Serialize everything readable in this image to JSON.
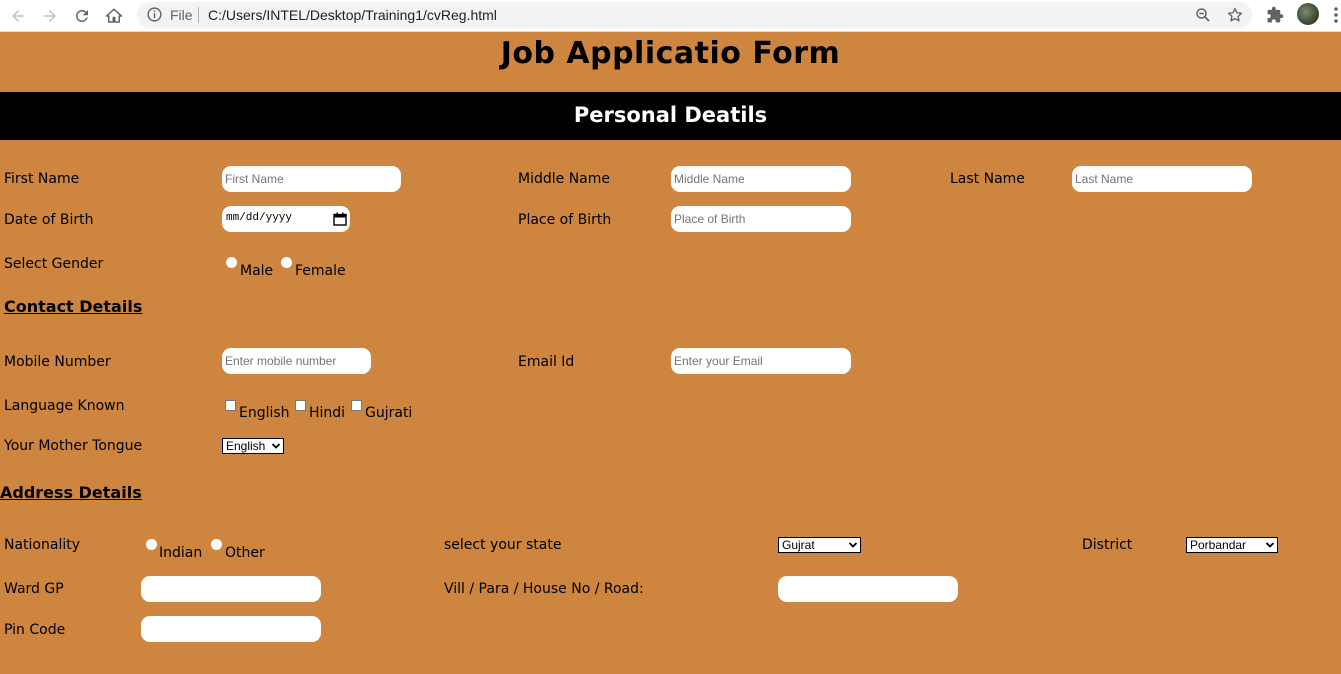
{
  "browser": {
    "file_label": "File",
    "url": "C:/Users/INTEL/Desktop/Training1/cvReg.html"
  },
  "form": {
    "title": "Job Applicatio Form",
    "section_title": "Personal Deatils",
    "personal": {
      "first_name_label": "First Name",
      "first_name_placeholder": "First Name",
      "middle_name_label": "Middle Name",
      "middle_name_placeholder": "Middle Name",
      "last_name_label": "Last Name",
      "last_name_placeholder": "Last Name",
      "dob_label": "Date of Birth",
      "dob_value": "mm/dd/yyyy",
      "pob_label": "Place of Birth",
      "pob_placeholder": "Place of Birth",
      "gender_label": "Select Gender",
      "gender_options": [
        "Male",
        "Female"
      ]
    },
    "contact": {
      "heading": "Contact Details",
      "mobile_label": "Mobile Number",
      "mobile_placeholder": "Enter mobile number",
      "email_label": "Email Id",
      "email_placeholder": "Enter your Email",
      "language_label": "Language Known",
      "languages": [
        "English",
        "Hindi",
        "Gujrati"
      ],
      "mother_tongue_label": "Your Mother Tongue",
      "mother_tongue_selected": "English"
    },
    "address": {
      "heading": "Address Details",
      "nationality_label": "Nationality",
      "nationality_options": [
        "Indian",
        "Other"
      ],
      "state_label": "select your state",
      "state_selected": "Gujrat",
      "district_label": "District",
      "district_selected": "Porbandar",
      "ward_label": "Ward GP",
      "ward_value": "",
      "village_label": "Vill / Para / House No / Road:",
      "village_value": "",
      "pincode_label": "Pin Code",
      "pincode_value": ""
    }
  }
}
